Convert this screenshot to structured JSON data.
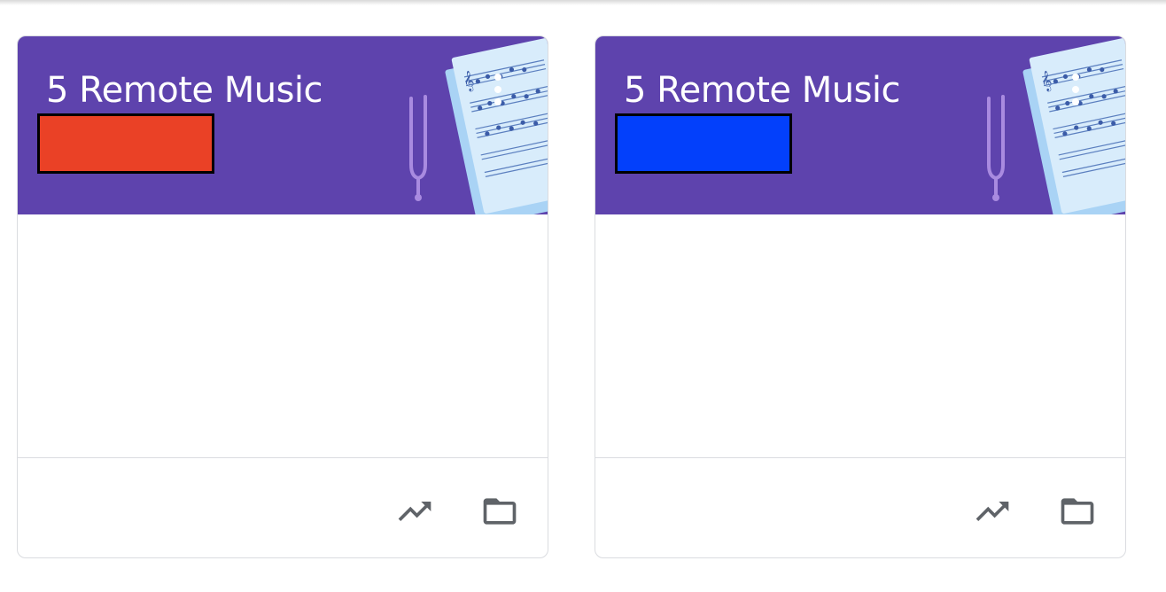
{
  "colors": {
    "banner": "#5e43ad",
    "redaction_left": "#ea4126",
    "redaction_right": "#0340fb",
    "icon_gray": "#5f6368",
    "border": "#dadce0"
  },
  "cards": [
    {
      "title": "5 Remote Music",
      "redaction_color": "#ea4126",
      "actions": [
        {
          "icon": "trending-up-icon"
        },
        {
          "icon": "folder-icon"
        }
      ]
    },
    {
      "title": "5 Remote Music",
      "redaction_color": "#0340fb",
      "actions": [
        {
          "icon": "trending-up-icon"
        },
        {
          "icon": "folder-icon"
        }
      ]
    }
  ]
}
